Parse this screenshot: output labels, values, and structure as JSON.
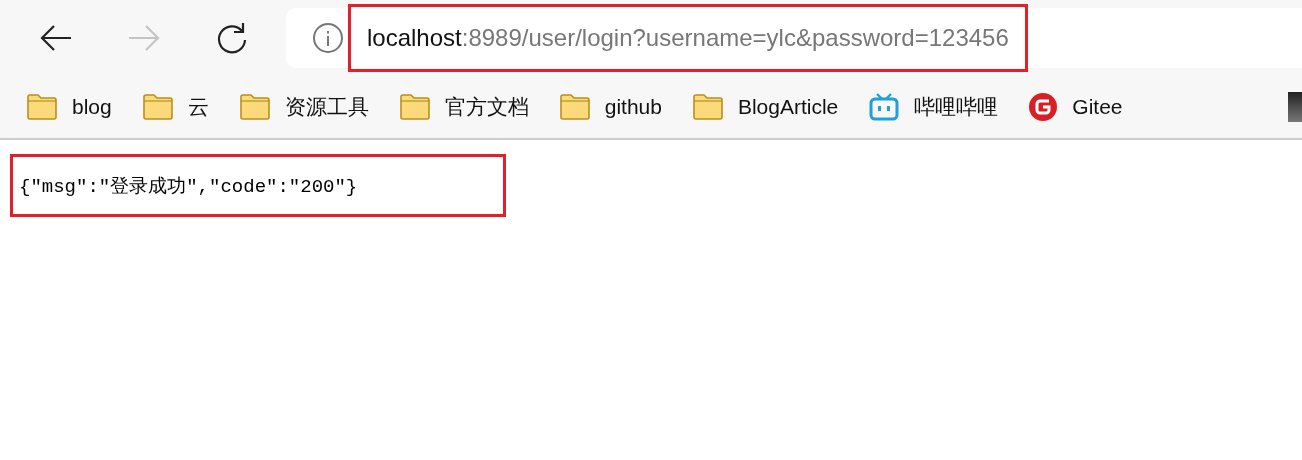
{
  "nav": [
    {
      "kind": "back",
      "disabled": false
    },
    {
      "kind": "forward",
      "disabled": true
    },
    {
      "kind": "reload",
      "disabled": false
    }
  ],
  "address_bar": {
    "host": "localhost",
    "rest": ":8989/user/login?username=ylc&password=123456",
    "highlighted": true
  },
  "bookmarks": [
    {
      "kind": "folder",
      "label": "blog"
    },
    {
      "kind": "folder",
      "label": "云"
    },
    {
      "kind": "folder",
      "label": "资源工具"
    },
    {
      "kind": "folder",
      "label": "官方文档"
    },
    {
      "kind": "folder",
      "label": "github"
    },
    {
      "kind": "folder",
      "label": "BlogArticle"
    },
    {
      "kind": "tv",
      "label": "哔哩哔哩"
    },
    {
      "kind": "gitee",
      "label": "Gitee"
    },
    {
      "kind": "image"
    }
  ],
  "response": {
    "text": "{\"msg\":\"登录成功\",\"code\":\"200\"}",
    "highlighted": true
  }
}
